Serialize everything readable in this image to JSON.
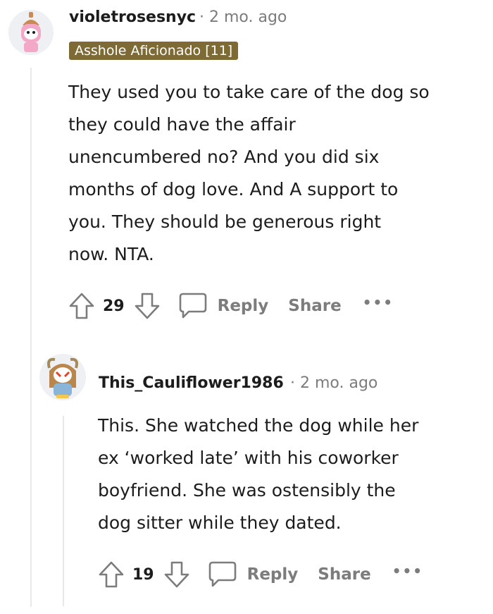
{
  "comments": [
    {
      "username": "violetrosesnyc",
      "separator": "·",
      "time": "2 mo. ago",
      "flair": "Asshole Aficionado [11]",
      "body": "They used you to take care of the dog so\nthey could have the affair\nunencumbered no? And you did six\nmonths of dog love. And A support to\nyou. They should be generous right\nnow. NTA.",
      "votes": "29",
      "reply_label": "Reply",
      "share_label": "Share",
      "more_label": "•••"
    },
    {
      "username": "This_Cauliflower1986",
      "separator": "·",
      "time": "2 mo. ago",
      "body": "This. She watched the dog while her\nex ‘worked late’ with his coworker\nboyfriend. She was ostensibly the\ndog sitter while they dated.",
      "votes": "19",
      "reply_label": "Reply",
      "share_label": "Share",
      "more_label": "•••"
    }
  ]
}
